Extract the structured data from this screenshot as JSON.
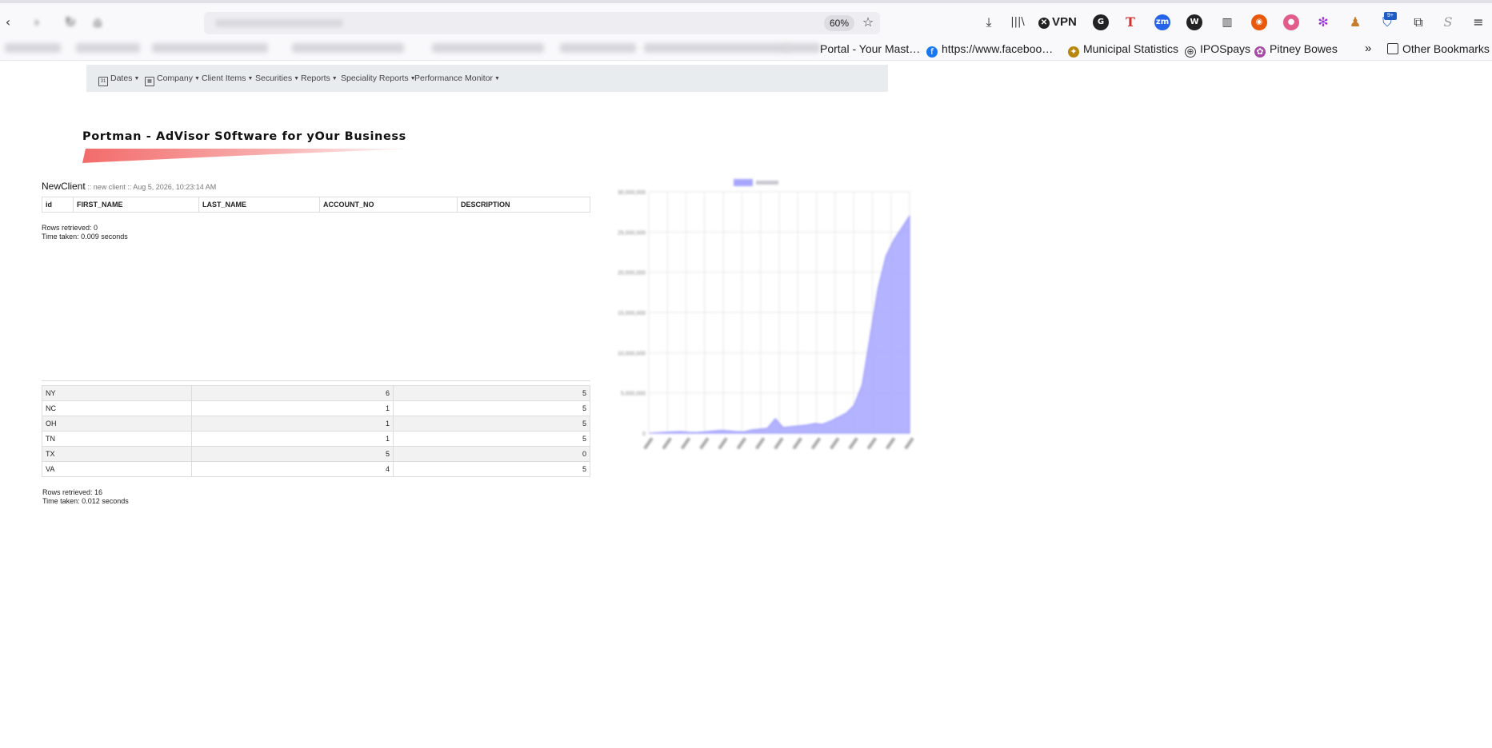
{
  "browser": {
    "zoom": "60%",
    "vpn_label": "VPN",
    "bookmarks": [
      {
        "label": "Portal - Your Mast…",
        "icon": "none"
      },
      {
        "label": "https://www.faceboo…",
        "icon": "facebook-icon"
      },
      {
        "label": "Municipal Statistics",
        "icon": "seal-icon"
      },
      {
        "label": "IPOSpays",
        "icon": "globe-icon"
      },
      {
        "label": "Pitney Bowes",
        "icon": "pitney-icon"
      }
    ],
    "other_bookmarks": "Other Bookmarks",
    "badge": "9+"
  },
  "nav": {
    "items": [
      {
        "label": "Dates",
        "icon": "calendar-icon"
      },
      {
        "label": "Company",
        "icon": "building-icon"
      },
      {
        "label": "Client Items"
      },
      {
        "label": "Securities"
      },
      {
        "label": "Reports"
      },
      {
        "label": "Speciality Reports"
      },
      {
        "label": "Performance Monitor"
      }
    ]
  },
  "brand": {
    "title": "Portman - AdVisor S0ftware for yOur Business",
    "swoosh_color": "#f36b6b"
  },
  "newclient": {
    "title": "NewClient",
    "subtitle": " :: new client :: Aug 5, 2026, 10:23:14 AM",
    "columns": [
      "id",
      "FIRST_NAME",
      "LAST_NAME",
      "ACCOUNT_NO",
      "DESCRIPTION"
    ],
    "rows_retrieved": "Rows retrieved: 0",
    "time_taken": "Time taken: 0.009 seconds"
  },
  "states": {
    "rows": [
      {
        "state": "NY",
        "a": "6",
        "b": "5"
      },
      {
        "state": "NC",
        "a": "1",
        "b": "5"
      },
      {
        "state": "OH",
        "a": "1",
        "b": "5"
      },
      {
        "state": "TN",
        "a": "1",
        "b": "5"
      },
      {
        "state": "TX",
        "a": "5",
        "b": "0"
      },
      {
        "state": "VA",
        "a": "4",
        "b": "5"
      }
    ],
    "rows_retrieved": "Rows retrieved: 16",
    "time_taken": "Time taken: 0.012 seconds"
  },
  "chart_data": {
    "type": "area",
    "color": "#a7a6ff",
    "y_ticks": [
      "30,000,000",
      "25,000,000",
      "20,000,000",
      "15,000,000",
      "10,000,000",
      "5,000,000",
      "0"
    ],
    "ylim": [
      0,
      30000000
    ],
    "values": [
      0,
      50000,
      100000,
      150000,
      200000,
      100000,
      80000,
      150000,
      250000,
      350000,
      300000,
      200000,
      150000,
      400000,
      500000,
      600000,
      1800000,
      700000,
      800000,
      900000,
      1000000,
      1200000,
      1100000,
      1500000,
      2000000,
      2500000,
      3500000,
      6000000,
      12000000,
      18000000,
      22000000,
      24000000,
      25500000,
      27000000
    ]
  }
}
